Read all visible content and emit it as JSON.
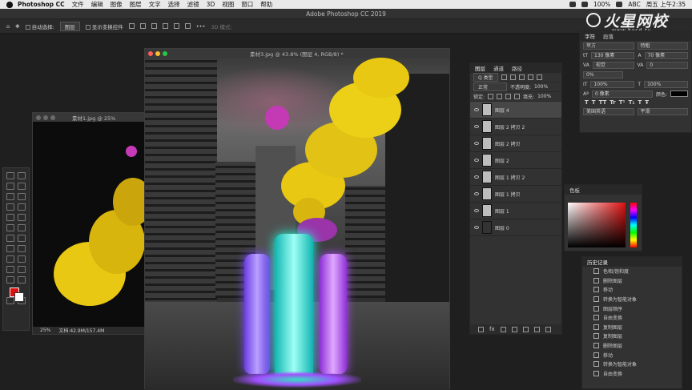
{
  "menubar": {
    "app_name": "Photoshop CC",
    "items": [
      "文件",
      "编辑",
      "图像",
      "图层",
      "文字",
      "选择",
      "滤镜",
      "3D",
      "视图",
      "窗口",
      "帮助"
    ],
    "battery": "100%",
    "user": "ABC",
    "clock": "周五 上午2:35"
  },
  "app_title": "Adobe Photoshop CC 2019",
  "options_bar": {
    "auto_select_label": "自动选择:",
    "auto_select_value": "图层",
    "show_transform_label": "显示变换控件",
    "mode_3d": "3D 模式:"
  },
  "watermark": {
    "brand": "火星网校",
    "url": "www.hxsd.tv"
  },
  "doc_back": {
    "title": "素材1.jpg @ 25%",
    "zoom": "25%",
    "doc_size": "文档:42.9M/157.4M"
  },
  "doc_main": {
    "title": "素材3.jpg @ 43.8% (图层 4, RGB/8) *"
  },
  "layers_panel": {
    "tabs": [
      "图层",
      "通道",
      "路径"
    ],
    "filter_label": "Q 类型",
    "blend_mode": "正常",
    "opacity_label": "不透明度:",
    "opacity": "100%",
    "lock_label": "锁定:",
    "fill_label": "填充:",
    "fill": "100%",
    "layers": [
      "图层 4",
      "图层 2 拷贝 2",
      "图层 2 拷贝",
      "图层 2",
      "图层 1 拷贝 2",
      "图层 1 拷贝",
      "图层 1",
      "图层 0"
    ],
    "selected_index": 0
  },
  "char_panel": {
    "tabs": [
      "字符",
      "段落"
    ],
    "font_family": "苹方",
    "font_style": "特粗",
    "font_size": "130 像素",
    "leading": "70 像素",
    "kerning": "视觉",
    "tracking": "0",
    "vscale": "100%",
    "hscale": "100%",
    "baseline": "0 像素",
    "color_label": "颜色:",
    "language": "美国英语",
    "aa": "平滑",
    "format_buttons": [
      "T",
      "T",
      "TT",
      "Tr",
      "T¹",
      "T₁",
      "T",
      "Ŧ"
    ]
  },
  "color_panel": {
    "title": "色板",
    "fg": "#e01010"
  },
  "history_panel": {
    "title": "历史记录",
    "items": [
      "色相/饱和度",
      "删除图层",
      "移动",
      "转换为智能对象",
      "图层顺序",
      "自由变换",
      "复制图层",
      "复制图层",
      "删除图层",
      "移动",
      "转换为智能对象",
      "自由变换"
    ]
  }
}
